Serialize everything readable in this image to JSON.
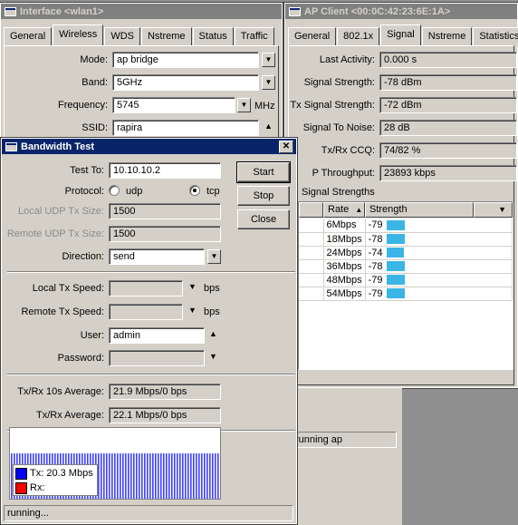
{
  "interface_window": {
    "title": "Interface <wlan1>",
    "tabs": [
      "General",
      "Wireless",
      "WDS",
      "Nstreme",
      "Status",
      "Traffic"
    ],
    "selected_tab": "Wireless",
    "fields": {
      "mode_label": "Mode:",
      "mode_value": "ap bridge",
      "band_label": "Band:",
      "band_value": "5GHz",
      "frequency_label": "Frequency:",
      "frequency_value": "5745",
      "frequency_unit": "MHz",
      "ssid_label": "SSID:",
      "ssid_value": "rapira"
    }
  },
  "apclient_window": {
    "title": "AP Client <00:0C:42:23:6E:1A>",
    "tabs": [
      "General",
      "802.1x",
      "Signal",
      "Nstreme",
      "Statistics"
    ],
    "selected_tab": "Signal",
    "fields": {
      "last_activity_label": "Last Activity:",
      "last_activity_value": "0.000 s",
      "signal_strength_label": "Signal Strength:",
      "signal_strength_value": "-78 dBm",
      "tx_signal_label": "Tx Signal Strength:",
      "tx_signal_value": "-72 dBm",
      "snr_label": "Signal To Noise:",
      "snr_value": "28 dB",
      "ccq_label": "Tx/Rx CCQ:",
      "ccq_value": "74/82 %",
      "throughput_label": "P Throughput:",
      "throughput_value": "23893 kbps"
    },
    "signal_group_label": "Signal Strengths",
    "table": {
      "col_rate": "Rate",
      "col_strength": "Strength",
      "rows": [
        {
          "rate": "6Mbps",
          "strength": "-79",
          "level": 0.79
        },
        {
          "rate": "18Mbps",
          "strength": "-78",
          "level": 0.78
        },
        {
          "rate": "24Mbps",
          "strength": "-74",
          "level": 0.74
        },
        {
          "rate": "36Mbps",
          "strength": "-78",
          "level": 0.78
        },
        {
          "rate": "48Mbps",
          "strength": "-79",
          "level": 0.79
        },
        {
          "rate": "54Mbps",
          "strength": "-79",
          "level": 0.79
        }
      ]
    },
    "status_text": "running ap"
  },
  "bandwidth_window": {
    "title": "Bandwidth Test",
    "test_to_label": "Test To:",
    "test_to_value": "10.10.10.2",
    "protocol_label": "Protocol:",
    "udp_label": "udp",
    "tcp_label": "tcp",
    "protocol_selected": "tcp",
    "local_udp_label": "Local UDP Tx Size:",
    "local_udp_value": "1500",
    "remote_udp_label": "Remote UDP Tx Size:",
    "remote_udp_value": "1500",
    "direction_label": "Direction:",
    "direction_value": "send",
    "local_speed_label": "Local Tx Speed:",
    "remote_speed_label": "Remote Tx Speed:",
    "speed_unit": "bps",
    "user_label": "User:",
    "user_value": "admin",
    "password_label": "Password:",
    "avg10_label": "Tx/Rx 10s Average:",
    "avg10_value": "21.9 Mbps/0 bps",
    "avg_label": "Tx/Rx Average:",
    "avg_value": "22.1 Mbps/0 bps",
    "buttons": {
      "start": "Start",
      "stop": "Stop",
      "close": "Close"
    },
    "graph_legend": {
      "tx": "Tx:  20.3 Mbps",
      "rx": "Rx:"
    },
    "colors": {
      "tx": "#0000ff",
      "rx": "#ff0000"
    },
    "status_text": "running..."
  }
}
